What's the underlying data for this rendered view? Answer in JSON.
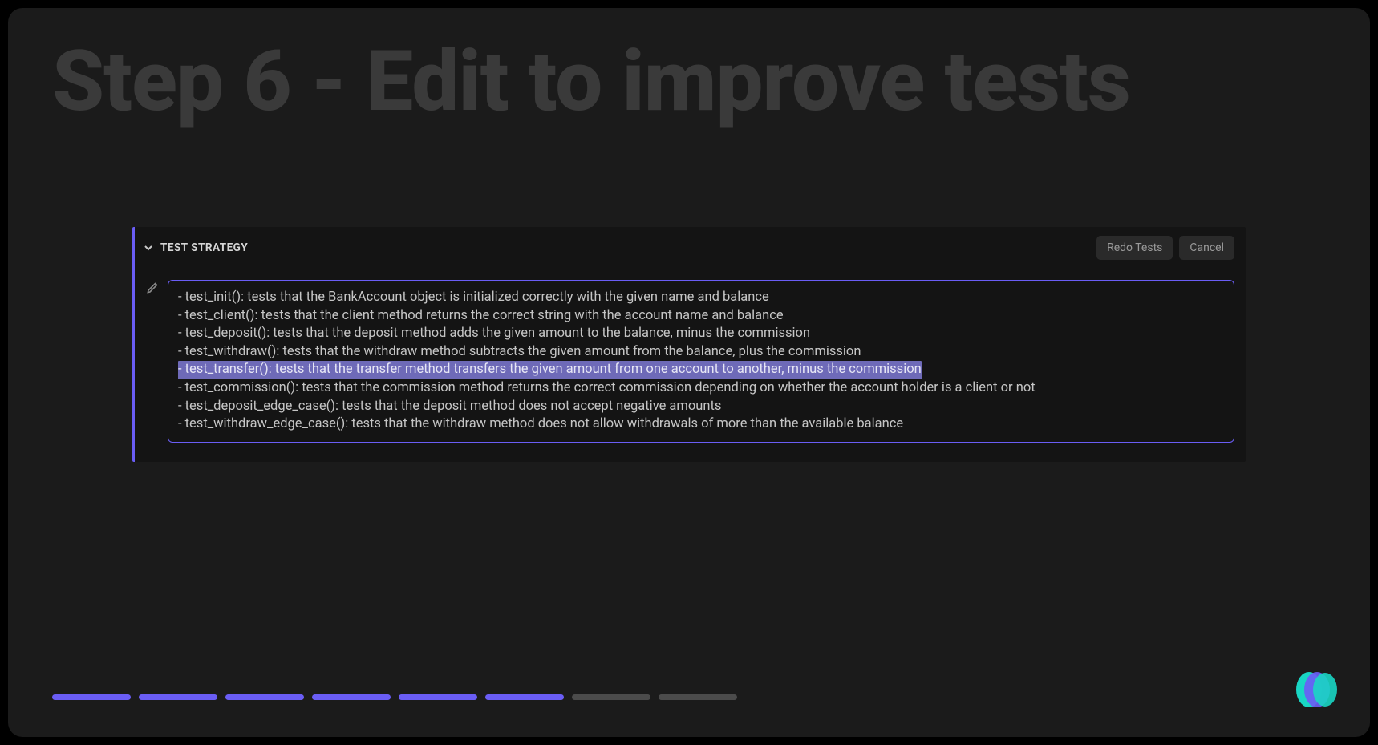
{
  "page": {
    "title": "Step 6 - Edit to improve tests"
  },
  "panel": {
    "title": "TEST STRATEGY",
    "buttons": {
      "redo": "Redo Tests",
      "cancel": "Cancel"
    }
  },
  "editor": {
    "lines": [
      "- test_init(): tests that the BankAccount object is initialized correctly with the given name and balance",
      "- test_client(): tests that the client method returns the correct string with the account name and balance",
      "- test_deposit(): tests that the deposit method adds the given amount to the balance, minus the commission",
      "- test_withdraw(): tests that the withdraw method subtracts the given amount from the balance, plus the commission",
      "- test_transfer(): tests that the transfer method transfers the given amount from one account to another, minus the commission",
      "- test_commission(): tests that the commission method returns the correct commission depending on whether the account holder is a client or not",
      "- test_deposit_edge_case(): tests that the deposit method does not accept negative amounts",
      "- test_withdraw_edge_case(): tests that the withdraw method does not allow withdrawals of more than the available balance"
    ],
    "selected_index": 4
  },
  "progress": {
    "total": 8,
    "current": 6
  },
  "colors": {
    "accent": "#6a5df5",
    "bg": "#1b1b1b",
    "panel_bg": "#141414"
  },
  "icons": {
    "chevron": "chevron-down-icon",
    "pencil": "pencil-icon",
    "logo": "brand-logo"
  }
}
